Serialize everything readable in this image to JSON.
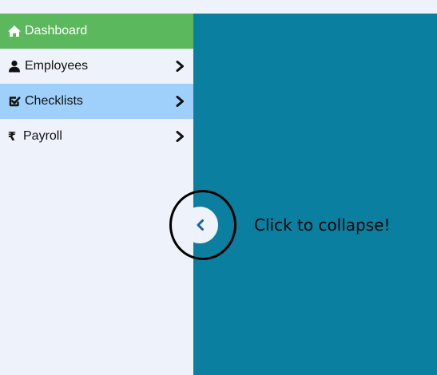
{
  "sidebar": {
    "items": [
      {
        "label": "Dashboard",
        "icon": "home-icon",
        "state": "active"
      },
      {
        "label": "Employees",
        "icon": "user-icon",
        "has_submenu": true
      },
      {
        "label": "Checklists",
        "icon": "check-square-icon",
        "has_submenu": true,
        "state": "highlighted"
      },
      {
        "label": "Payroll",
        "icon": "rupee-icon",
        "icon_glyph": "₹",
        "has_submenu": true
      }
    ]
  },
  "collapse_button": {
    "icon": "chevron-left-icon"
  },
  "annotation": {
    "text": "Click to collapse!"
  },
  "colors": {
    "sidebar_bg": "#eef3fb",
    "active_item": "#5cb85c",
    "highlight_item": "#9fd0fb",
    "main_panel": "#0b7f9f",
    "chevron": "#1f5f9f"
  }
}
